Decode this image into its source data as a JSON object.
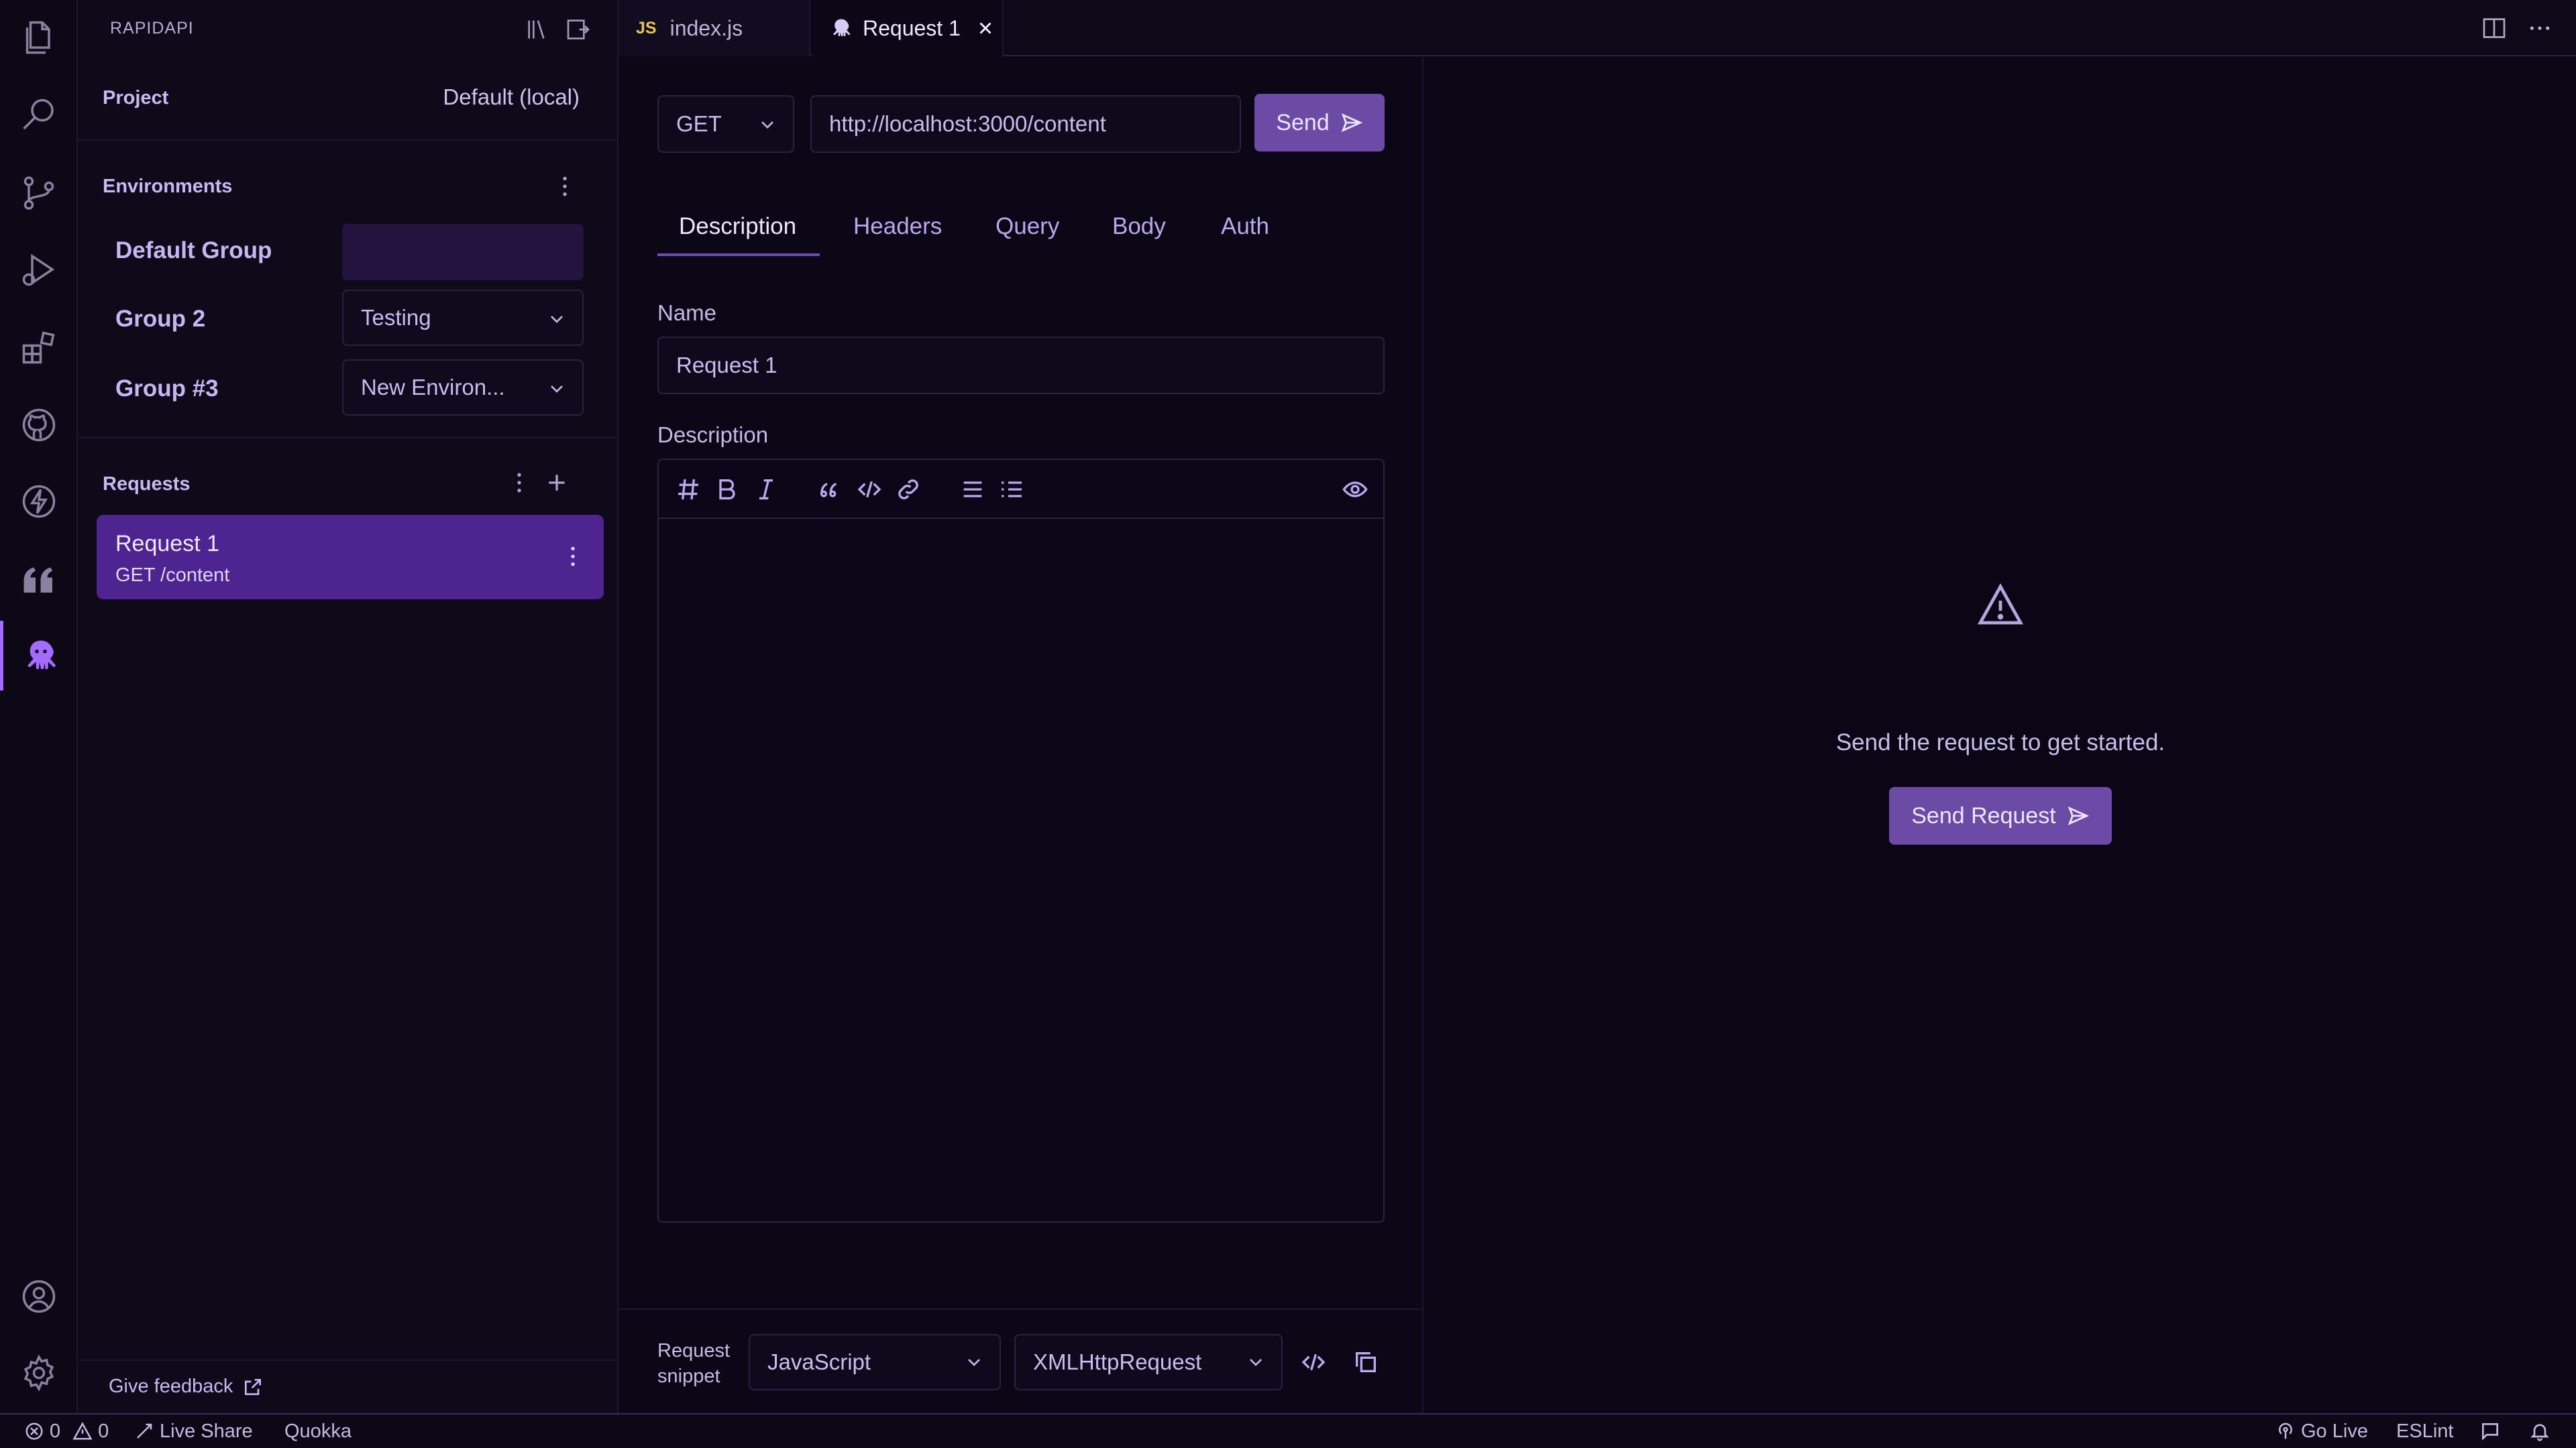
{
  "colors": {
    "accent": "#a36bff",
    "selected_request": "#4e2590",
    "button": "#6b4ba5"
  },
  "activity_bar": {
    "icons": [
      "explorer-icon",
      "search-icon",
      "source-control-icon",
      "run-debug-icon",
      "extensions-icon",
      "github-icon",
      "bolt-icon",
      "quote-icon",
      "rapidapi-octopus-icon",
      "account-icon",
      "settings-gear-icon"
    ]
  },
  "sidebar": {
    "title": "RAPIDAPI",
    "project": {
      "label": "Project",
      "value": "Default (local)"
    },
    "environments": {
      "label": "Environments",
      "groups": [
        {
          "name": "Default Group",
          "value": ""
        },
        {
          "name": "Group 2",
          "value": "Testing"
        },
        {
          "name": "Group #3",
          "value": "New Environ..."
        }
      ]
    },
    "requests": {
      "label": "Requests",
      "items": [
        {
          "name": "Request 1",
          "detail": "GET /content"
        }
      ]
    },
    "feedback": "Give feedback"
  },
  "tabs": [
    {
      "badge": "JS",
      "label": "index.js"
    },
    {
      "label": "Request 1"
    }
  ],
  "request": {
    "method": "GET",
    "url": "http://localhost:3000/content",
    "send_label": "Send",
    "tabs": [
      "Description",
      "Headers",
      "Query",
      "Body",
      "Auth"
    ],
    "active_tab": "Description",
    "name_label": "Name",
    "name_value": "Request 1",
    "description_label": "Description",
    "snippet": {
      "label_line1": "Request",
      "label_line2": "snippet",
      "language": "JavaScript",
      "library": "XMLHttpRequest"
    }
  },
  "response": {
    "message": "Send the request to get started.",
    "button": "Send Request"
  },
  "statusbar": {
    "errors": "0",
    "warnings": "0",
    "live_share": "Live Share",
    "quokka": "Quokka",
    "go_live": "Go Live",
    "eslint": "ESLint"
  }
}
